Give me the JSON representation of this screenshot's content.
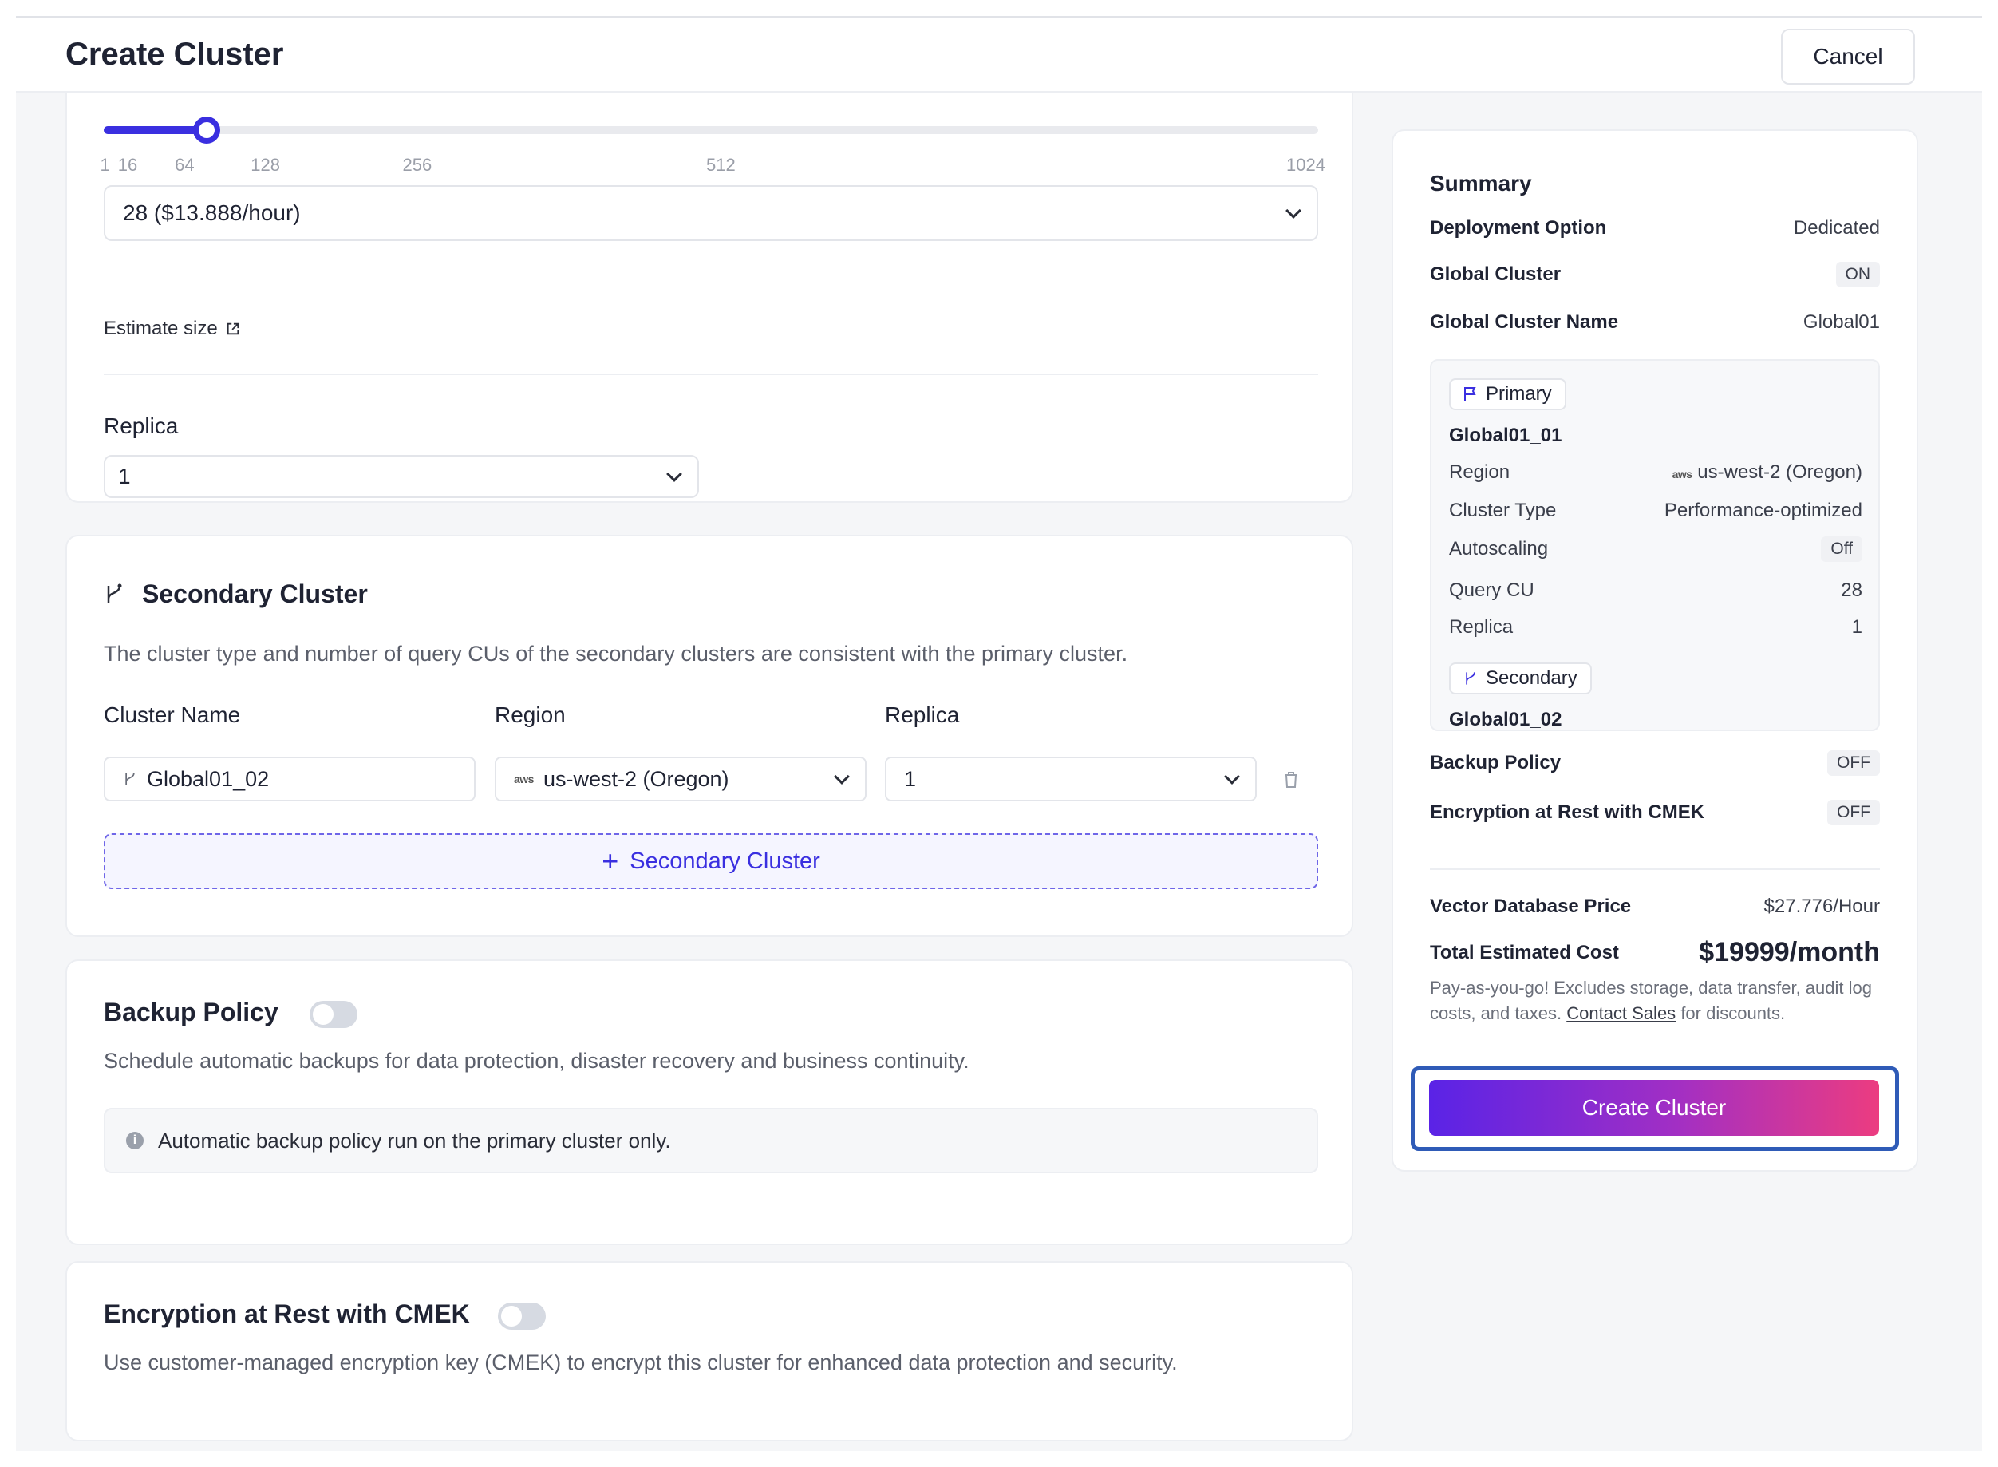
{
  "header": {
    "title": "Create Cluster",
    "cancel_label": "Cancel"
  },
  "query_cu": {
    "slider_ticks": [
      "1",
      "16",
      "64",
      "128",
      "256",
      "512",
      "1024"
    ],
    "slider_value": 28,
    "selected": "28 ($13.888/hour)",
    "estimate_label": "Estimate size",
    "replica_label": "Replica",
    "replica_value": "1"
  },
  "secondary": {
    "title": "Secondary Cluster",
    "description": "The cluster type and number of query CUs of the secondary clusters are consistent with the primary cluster.",
    "col_name": "Cluster Name",
    "col_region": "Region",
    "col_replica": "Replica",
    "row": {
      "name": "Global01_02",
      "region_provider": "aws",
      "region": "us-west-2 (Oregon)",
      "replica": "1"
    },
    "add_label": "Secondary Cluster"
  },
  "backup": {
    "title": "Backup Policy",
    "description": "Schedule automatic backups for data protection, disaster recovery and business continuity.",
    "info": "Automatic backup policy run on the primary cluster only."
  },
  "encryption": {
    "title": "Encryption at Rest with CMEK",
    "description": "Use customer-managed encryption key (CMEK) to encrypt this cluster for enhanced data protection and security."
  },
  "summary": {
    "title": "Summary",
    "deployment_label": "Deployment Option",
    "deployment_value": "Dedicated",
    "global_label": "Global Cluster",
    "global_value": "ON",
    "global_name_label": "Global Cluster Name",
    "global_name_value": "Global01",
    "primary_tag": "Primary",
    "primary_name": "Global01_01",
    "region_label": "Region",
    "region_provider": "aws",
    "region_value": "us-west-2 (Oregon)",
    "cluster_type_label": "Cluster Type",
    "cluster_type_value": "Performance-optimized",
    "autoscaling_label": "Autoscaling",
    "autoscaling_value": "Off",
    "query_cu_label": "Query CU",
    "query_cu_value": "28",
    "replica_label": "Replica",
    "replica_value": "1",
    "secondary_tag": "Secondary",
    "secondary_name": "Global01_02",
    "backup_label": "Backup Policy",
    "backup_value": "OFF",
    "encryption_label": "Encryption at Rest with CMEK",
    "encryption_value": "OFF",
    "price_label": "Vector Database Price",
    "price_value": "$27.776/Hour",
    "total_label": "Total Estimated Cost",
    "total_value": "$19999/month",
    "note_pre": "Pay-as-you-go! Excludes storage, data transfer, audit log costs, and taxes.",
    "note_link": "Contact Sales",
    "note_post": "for discounts.",
    "create_label": "Create Cluster"
  },
  "colors": {
    "accent": "#3a2fe0",
    "gradient_start": "#5a23e6",
    "gradient_end": "#ec3c80",
    "focus_ring": "#2f5bb7"
  }
}
